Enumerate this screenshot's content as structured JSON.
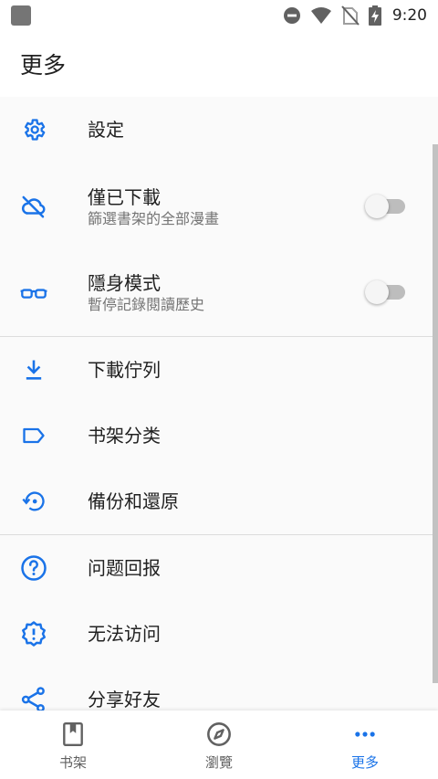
{
  "status_bar": {
    "time": "9:20"
  },
  "app_bar": {
    "title": "更多"
  },
  "colors": {
    "accent": "#1a73e8",
    "text_primary": "#212121",
    "text_secondary": "#757575",
    "switch_off": "#bdbdbd"
  },
  "menu": {
    "settings": {
      "label": "設定",
      "icon": "gear-icon"
    },
    "downloaded_only": {
      "label": "僅已下載",
      "subtitle": "篩選書架的全部漫畫",
      "icon": "cloud-off-icon",
      "enabled": false
    },
    "incognito": {
      "label": "隱身模式",
      "subtitle": "暫停記錄閱讀歷史",
      "icon": "glasses-icon",
      "enabled": false
    },
    "download_queue": {
      "label": "下載佇列",
      "icon": "download-icon"
    },
    "categories": {
      "label": "书架分类",
      "icon": "label-icon"
    },
    "backup_restore": {
      "label": "備份和還原",
      "icon": "restore-icon"
    },
    "report_issue": {
      "label": "问题回报",
      "icon": "help-circle-icon"
    },
    "cannot_access": {
      "label": "无法访问",
      "icon": "alert-badge-icon"
    },
    "share_friends": {
      "label": "分享好友",
      "icon": "share-icon"
    }
  },
  "bottom_nav": {
    "library": {
      "label": "书架",
      "icon": "bookmark-book-icon"
    },
    "browse": {
      "label": "瀏覽",
      "icon": "compass-icon"
    },
    "more": {
      "label": "更多",
      "icon": "more-dots-icon",
      "active": true
    }
  }
}
